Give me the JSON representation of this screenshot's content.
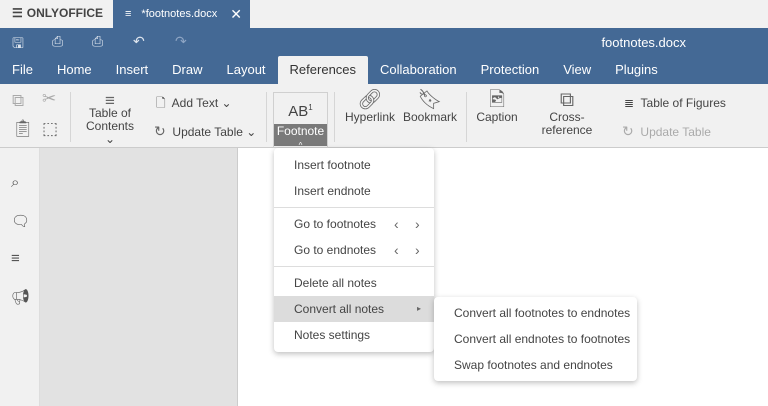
{
  "app": {
    "logo": "ONLYOFFICE",
    "tab_title": "*footnotes.docx",
    "window_title": "footnotes.docx"
  },
  "menu_tabs": [
    "File",
    "Home",
    "Insert",
    "Draw",
    "Layout",
    "References",
    "Collaboration",
    "Protection",
    "View",
    "Plugins"
  ],
  "active_tab": "References",
  "ribbon": {
    "toc": "Table of",
    "toc2": "Contents",
    "add_text": "Add Text",
    "update_table": "Update Table",
    "footnote": "Footnote",
    "hyperlink": "Hyperlink",
    "bookmark": "Bookmark",
    "caption": "Caption",
    "cross_reference": "Cross-reference",
    "table_of_figures": "Table of Figures",
    "update_table_2": "Update Table"
  },
  "footnote_menu": {
    "insert_footnote": "Insert footnote",
    "insert_endnote": "Insert endnote",
    "go_footnotes": "Go to footnotes",
    "go_endnotes": "Go to endnotes",
    "delete_all": "Delete all notes",
    "convert_all": "Convert all notes",
    "settings": "Notes settings"
  },
  "convert_submenu": [
    "Convert all footnotes to endnotes",
    "Convert all endnotes to footnotes",
    "Swap footnotes and endnotes"
  ],
  "colors": {
    "header": "#446995",
    "ribbon": "#f1f1f1",
    "highlight": "#dcdcdc"
  }
}
